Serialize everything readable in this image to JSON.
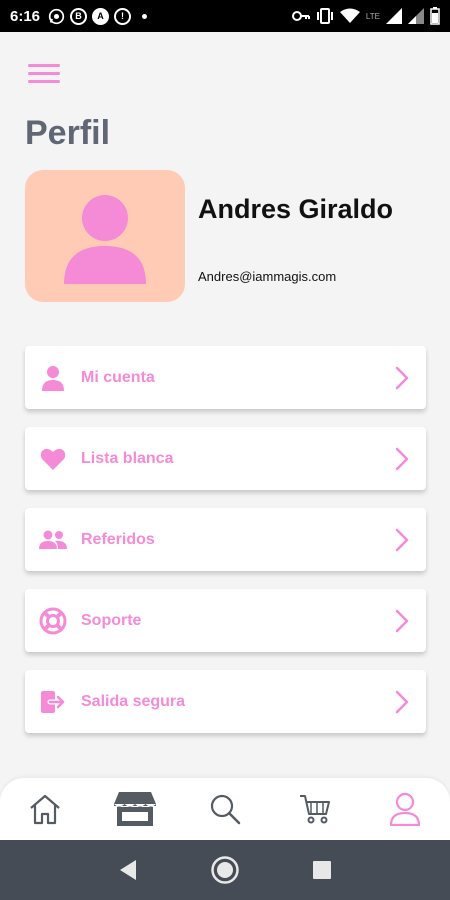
{
  "status_bar": {
    "time": "6:16",
    "icons_left": [
      "whatsapp-icon",
      "b-badge-icon",
      "a-badge-icon",
      "alert-icon"
    ],
    "icons_right": [
      "key-icon",
      "vibrate-icon",
      "wifi-icon",
      "signal-icon",
      "battery-icon"
    ],
    "network": "LTE"
  },
  "header": {
    "menu_icon": "hamburger-icon",
    "title": "Perfil"
  },
  "profile": {
    "avatar_icon": "user-icon",
    "name": "Andres Giraldo",
    "email": "Andres@iammagis.com"
  },
  "menu": {
    "items": [
      {
        "label": "Mi cuenta",
        "icon": "user-icon"
      },
      {
        "label": "Lista blanca",
        "icon": "heart-icon"
      },
      {
        "label": "Referidos",
        "icon": "users-icon"
      },
      {
        "label": "Soporte",
        "icon": "lifebuoy-icon"
      },
      {
        "label": "Salida segura",
        "icon": "logout-icon"
      }
    ]
  },
  "bottom_nav": {
    "items": [
      {
        "icon": "home-icon"
      },
      {
        "icon": "store-icon"
      },
      {
        "icon": "search-icon"
      },
      {
        "icon": "cart-icon"
      },
      {
        "icon": "profile-icon",
        "active": true
      }
    ]
  },
  "colors": {
    "accent": "#f58ad6",
    "title_gray": "#5f6774",
    "avatar_bg": "#ffcbb5",
    "nav_icon_gray": "#555b63",
    "android_bar": "#454c55"
  }
}
